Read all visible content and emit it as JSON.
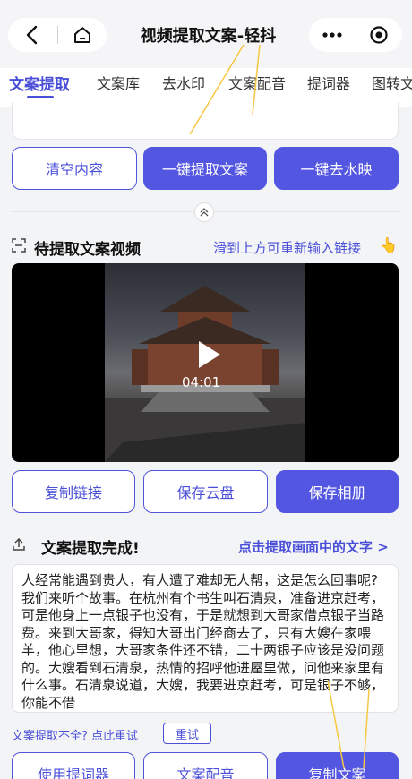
{
  "header": {
    "title": "视频提取文案-轻抖",
    "back_icon": "chevron-left-icon",
    "home_icon": "home-icon",
    "more_icon": "more-icon",
    "close_icon": "target-icon"
  },
  "tabs": [
    "文案提取",
    "文案库",
    "去水印",
    "文案配音",
    "提词器",
    "图转文"
  ],
  "active_tab": 0,
  "actions": {
    "clear": "清空内容",
    "extract": "一键提取文案",
    "remove_watermark": "一键去水映"
  },
  "video_section": {
    "title": "待提取文案视频",
    "hint": "滑到上方可重新输入链接",
    "duration": "04:01"
  },
  "video_actions": {
    "copy_link": "复制链接",
    "save_cloud": "保存云盘",
    "save_album": "保存相册"
  },
  "result_section": {
    "title": "文案提取完成!",
    "link": "点击提取画面中的文字 >",
    "text": "人经常能遇到贵人，有人遭了难却无人帮，这是怎么回事呢? 我们来听个故事。在杭州有个书生叫石清泉，准备进京赶考，可是他身上一点银子也没有，于是就想到大哥家借点银子当路费。来到大哥家，得知大哥出门经商去了，只有大嫂在家喂羊，他心里想，大哥家条件还不错，二十两银子应该是没问题的。大嫂看到石清泉，热情的招呼他进屋里做，问他来家里有什么事。石清泉说道，大嫂，我要进京赶考，可是银子不够，你能不借"
  },
  "retry": {
    "text": "文案提取不全? 点此重试",
    "button": "重试"
  },
  "bottom_actions": {
    "teleprompter": "使用提词器",
    "dubbing": "文案配音",
    "copy_text": "复制文案"
  },
  "colors": {
    "accent": "#4a4fd8",
    "button_fill": "#5356e0",
    "annotation": "#f5c842"
  }
}
